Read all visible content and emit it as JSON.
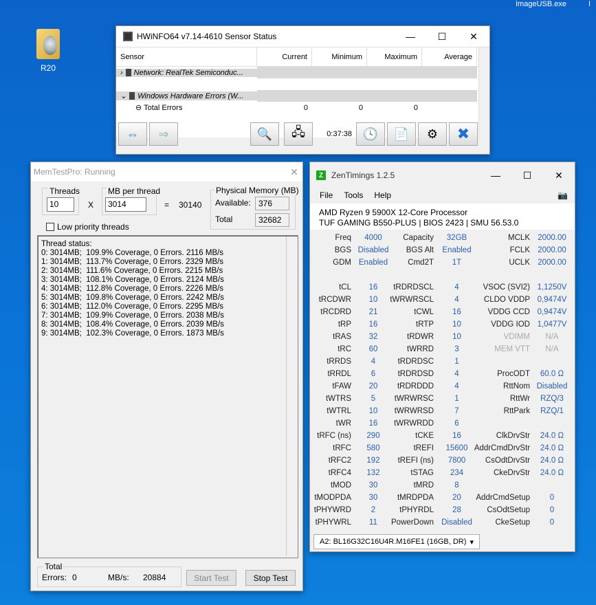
{
  "desktop": {
    "icon_label": "R20",
    "top_text_1": "ImageUSB.exe",
    "top_text_2": "I"
  },
  "hwinfo": {
    "title": "HWiNFO64 v7.14-4610 Sensor Status",
    "columns": [
      "Sensor",
      "Current",
      "Minimum",
      "Maximum",
      "Average"
    ],
    "groups": [
      {
        "label": "Network: RealTek Semiconduc..."
      },
      {
        "label": "Windows Hardware Errors (W..."
      }
    ],
    "row": {
      "label": "Total Errors",
      "current": "0",
      "minimum": "0",
      "maximum": "0",
      "average": ""
    },
    "timer": "0:37:38"
  },
  "memtest": {
    "title": "MemTestPro: Running",
    "threads_label": "Threads",
    "threads_value": "10",
    "times": "X",
    "mb_label": "MB per thread",
    "mb_value": "3014",
    "equals": "=",
    "total_mb": "30140",
    "phys_label": "Physical Memory (MB)",
    "available_label": "Available:",
    "available_value": "376",
    "total_label": "Total",
    "total_value": "32682",
    "low_priority": "Low priority threads",
    "log": [
      "Thread status:",
      "0: 3014MB;  109.9% Coverage, 0 Errors. 2116 MB/s",
      "1: 3014MB;  113.7% Coverage, 0 Errors. 2329 MB/s",
      "2: 3014MB;  111.6% Coverage, 0 Errors. 2215 MB/s",
      "3: 3014MB;  108.1% Coverage, 0 Errors. 2124 MB/s",
      "4: 3014MB;  112.8% Coverage, 0 Errors. 2226 MB/s",
      "5: 3014MB;  109.8% Coverage, 0 Errors. 2242 MB/s",
      "6: 3014MB;  112.0% Coverage, 0 Errors. 2295 MB/s",
      "7: 3014MB;  109.9% Coverage, 0 Errors. 2038 MB/s",
      "8: 3014MB;  108.4% Coverage, 0 Errors. 2039 MB/s",
      "9: 3014MB;  102.3% Coverage, 0 Errors. 1873 MB/s"
    ],
    "errors_label": "Errors:",
    "errors_value": "0",
    "mbs_label": "MB/s:",
    "mbs_value": "20884",
    "start_btn": "Start Test",
    "stop_btn": "Stop Test"
  },
  "zen": {
    "title": "ZenTimings 1.2.5",
    "menu": [
      "File",
      "Tools",
      "Help"
    ],
    "cpu": "AMD Ryzen 9 5900X 12-Core Processor",
    "board": "TUF GAMING B550-PLUS | BIOS 2423 | SMU 56.53.0",
    "rows": [
      [
        [
          "Freq",
          "4000"
        ],
        [
          "Capacity",
          "32GB"
        ],
        [
          "MCLK",
          "2000.00"
        ]
      ],
      [
        [
          "BGS",
          "Disabled"
        ],
        [
          "BGS Alt",
          "Enabled"
        ],
        [
          "FCLK",
          "2000.00"
        ]
      ],
      [
        [
          "GDM",
          "Enabled"
        ],
        [
          "Cmd2T",
          "1T"
        ],
        [
          "UCLK",
          "2000.00"
        ]
      ],
      null,
      [
        [
          "tCL",
          "16"
        ],
        [
          "tRDRDSCL",
          "4"
        ],
        [
          "VSOC (SVI2)",
          "1,1250V"
        ]
      ],
      [
        [
          "tRCDWR",
          "10"
        ],
        [
          "tWRWRSCL",
          "4"
        ],
        [
          "CLDO VDDP",
          "0,9474V"
        ]
      ],
      [
        [
          "tRCDRD",
          "21"
        ],
        [
          "tCWL",
          "16"
        ],
        [
          "VDDG CCD",
          "0,9474V"
        ]
      ],
      [
        [
          "tRP",
          "16"
        ],
        [
          "tRTP",
          "10"
        ],
        [
          "VDDG IOD",
          "1,0477V"
        ]
      ],
      [
        [
          "tRAS",
          "32"
        ],
        [
          "tRDWR",
          "10"
        ],
        [
          "VDIMM",
          "N/A"
        ]
      ],
      [
        [
          "tRC",
          "60"
        ],
        [
          "tWRRD",
          "3"
        ],
        [
          "MEM VTT",
          "N/A"
        ]
      ],
      [
        [
          "tRRDS",
          "4"
        ],
        [
          "tRDRDSC",
          "1"
        ],
        [
          "",
          ""
        ]
      ],
      [
        [
          "tRRDL",
          "6"
        ],
        [
          "tRDRDSD",
          "4"
        ],
        [
          "ProcODT",
          "60.0 Ω"
        ]
      ],
      [
        [
          "tFAW",
          "20"
        ],
        [
          "tRDRDDD",
          "4"
        ],
        [
          "RttNom",
          "Disabled"
        ]
      ],
      [
        [
          "tWTRS",
          "5"
        ],
        [
          "tWRWRSC",
          "1"
        ],
        [
          "RttWr",
          "RZQ/3"
        ]
      ],
      [
        [
          "tWTRL",
          "10"
        ],
        [
          "tWRWRSD",
          "7"
        ],
        [
          "RttPark",
          "RZQ/1"
        ]
      ],
      [
        [
          "tWR",
          "16"
        ],
        [
          "tWRWRDD",
          "6"
        ],
        [
          "",
          ""
        ]
      ],
      [
        [
          "tRFC (ns)",
          "290"
        ],
        [
          "tCKE",
          "16"
        ],
        [
          "ClkDrvStr",
          "24.0 Ω"
        ]
      ],
      [
        [
          "tRFC",
          "580"
        ],
        [
          "tREFI",
          "15600"
        ],
        [
          "AddrCmdDrvStr",
          "24.0 Ω"
        ]
      ],
      [
        [
          "tRFC2",
          "192"
        ],
        [
          "tREFI (ns)",
          "7800"
        ],
        [
          "CsOdtDrvStr",
          "24.0 Ω"
        ]
      ],
      [
        [
          "tRFC4",
          "132"
        ],
        [
          "tSTAG",
          "234"
        ],
        [
          "CkeDrvStr",
          "24.0 Ω"
        ]
      ],
      [
        [
          "tMOD",
          "30"
        ],
        [
          "tMRD",
          "8"
        ],
        [
          "",
          ""
        ]
      ],
      [
        [
          "tMODPDA",
          "30"
        ],
        [
          "tMRDPDA",
          "20"
        ],
        [
          "AddrCmdSetup",
          "0"
        ]
      ],
      [
        [
          "tPHYWRD",
          "2"
        ],
        [
          "tPHYRDL",
          "28"
        ],
        [
          "CsOdtSetup",
          "0"
        ]
      ],
      [
        [
          "tPHYWRL",
          "11"
        ],
        [
          "PowerDown",
          "Disabled"
        ],
        [
          "CkeSetup",
          "0"
        ]
      ]
    ],
    "dimm": "A2: BL16G32C16U4R.M16FE1 (16GB, DR)"
  }
}
